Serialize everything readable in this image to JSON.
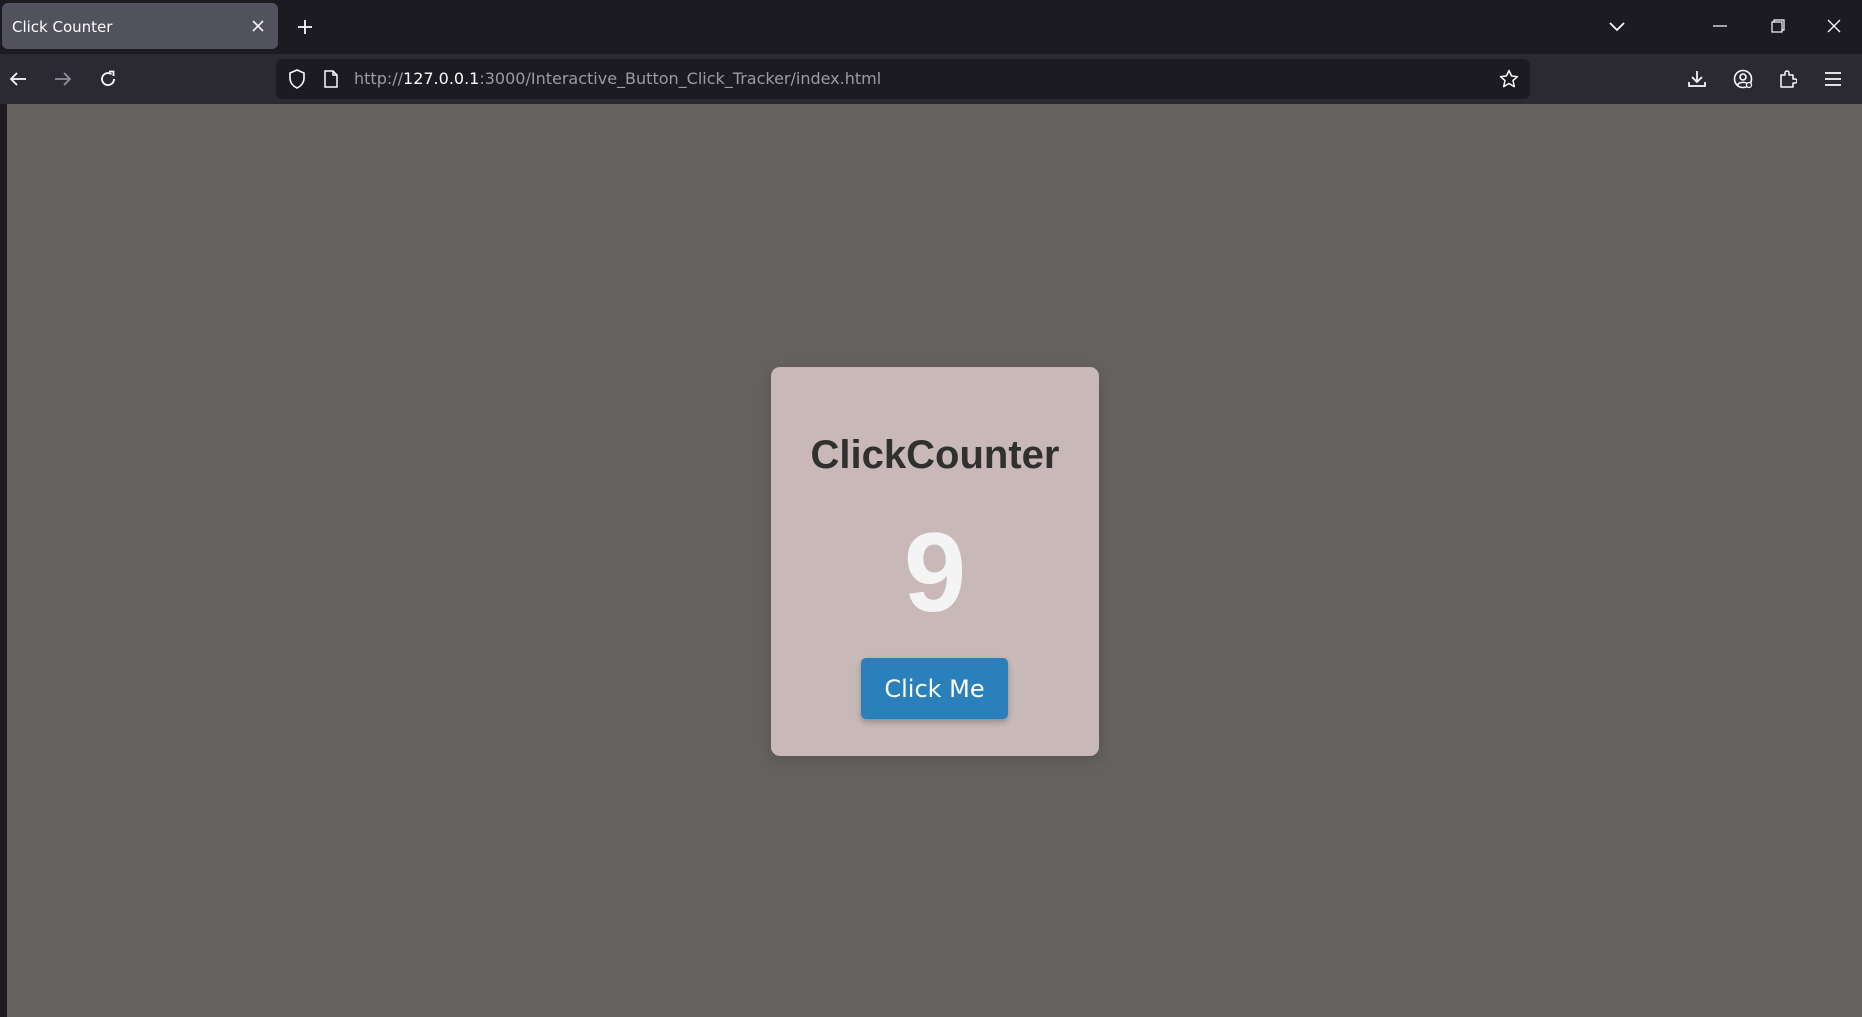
{
  "browser": {
    "tab": {
      "title": "Click Counter"
    },
    "url": {
      "scheme": "http://",
      "host": "127.0.0.1",
      "rest": ":3000/Interactive_Button_Click_Tracker/index.html"
    },
    "icons": {
      "close": "close-icon",
      "new_tab": "plus-icon",
      "tab_list": "chevron-down-icon",
      "minimize": "minimize-icon",
      "restore": "restore-icon",
      "window_close": "close-icon",
      "back": "back-arrow-icon",
      "forward": "forward-arrow-icon",
      "reload": "reload-icon",
      "shield": "shield-icon",
      "page": "page-icon",
      "bookmark": "star-icon",
      "downloads": "download-icon",
      "account": "account-icon",
      "extensions": "puzzle-icon",
      "menu": "hamburger-menu-icon"
    }
  },
  "page": {
    "title": "ClickCounter",
    "count": "9",
    "button_label": "Click Me"
  },
  "colors": {
    "page_background": "#656160",
    "card_background": "#c8b8b8",
    "button_background": "#2a80bb",
    "counter_text": "#f4f4f4",
    "title_text": "#303030"
  }
}
